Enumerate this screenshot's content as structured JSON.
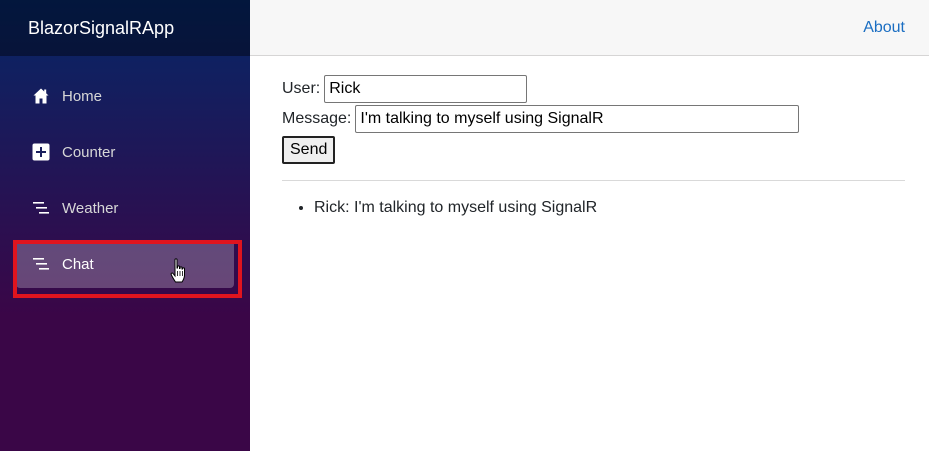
{
  "sidebar": {
    "brand": "BlazorSignalRApp",
    "items": [
      {
        "label": "Home",
        "icon": "home-icon"
      },
      {
        "label": "Counter",
        "icon": "plus-square-icon"
      },
      {
        "label": "Weather",
        "icon": "list-icon"
      },
      {
        "label": "Chat",
        "icon": "list-icon",
        "active": true
      }
    ]
  },
  "header": {
    "about_label": "About"
  },
  "chat": {
    "user_label": "User:",
    "user_value": "Rick",
    "message_label": "Message:",
    "message_value": "I'm talking to myself using SignalR",
    "send_label": "Send",
    "messages": [
      "Rick: I'm talking to myself using SignalR"
    ]
  },
  "colors": {
    "sidebar_top": "#052767",
    "sidebar_bottom": "#3a0647",
    "link": "#1b6ec2",
    "highlight": "#e0141e"
  }
}
